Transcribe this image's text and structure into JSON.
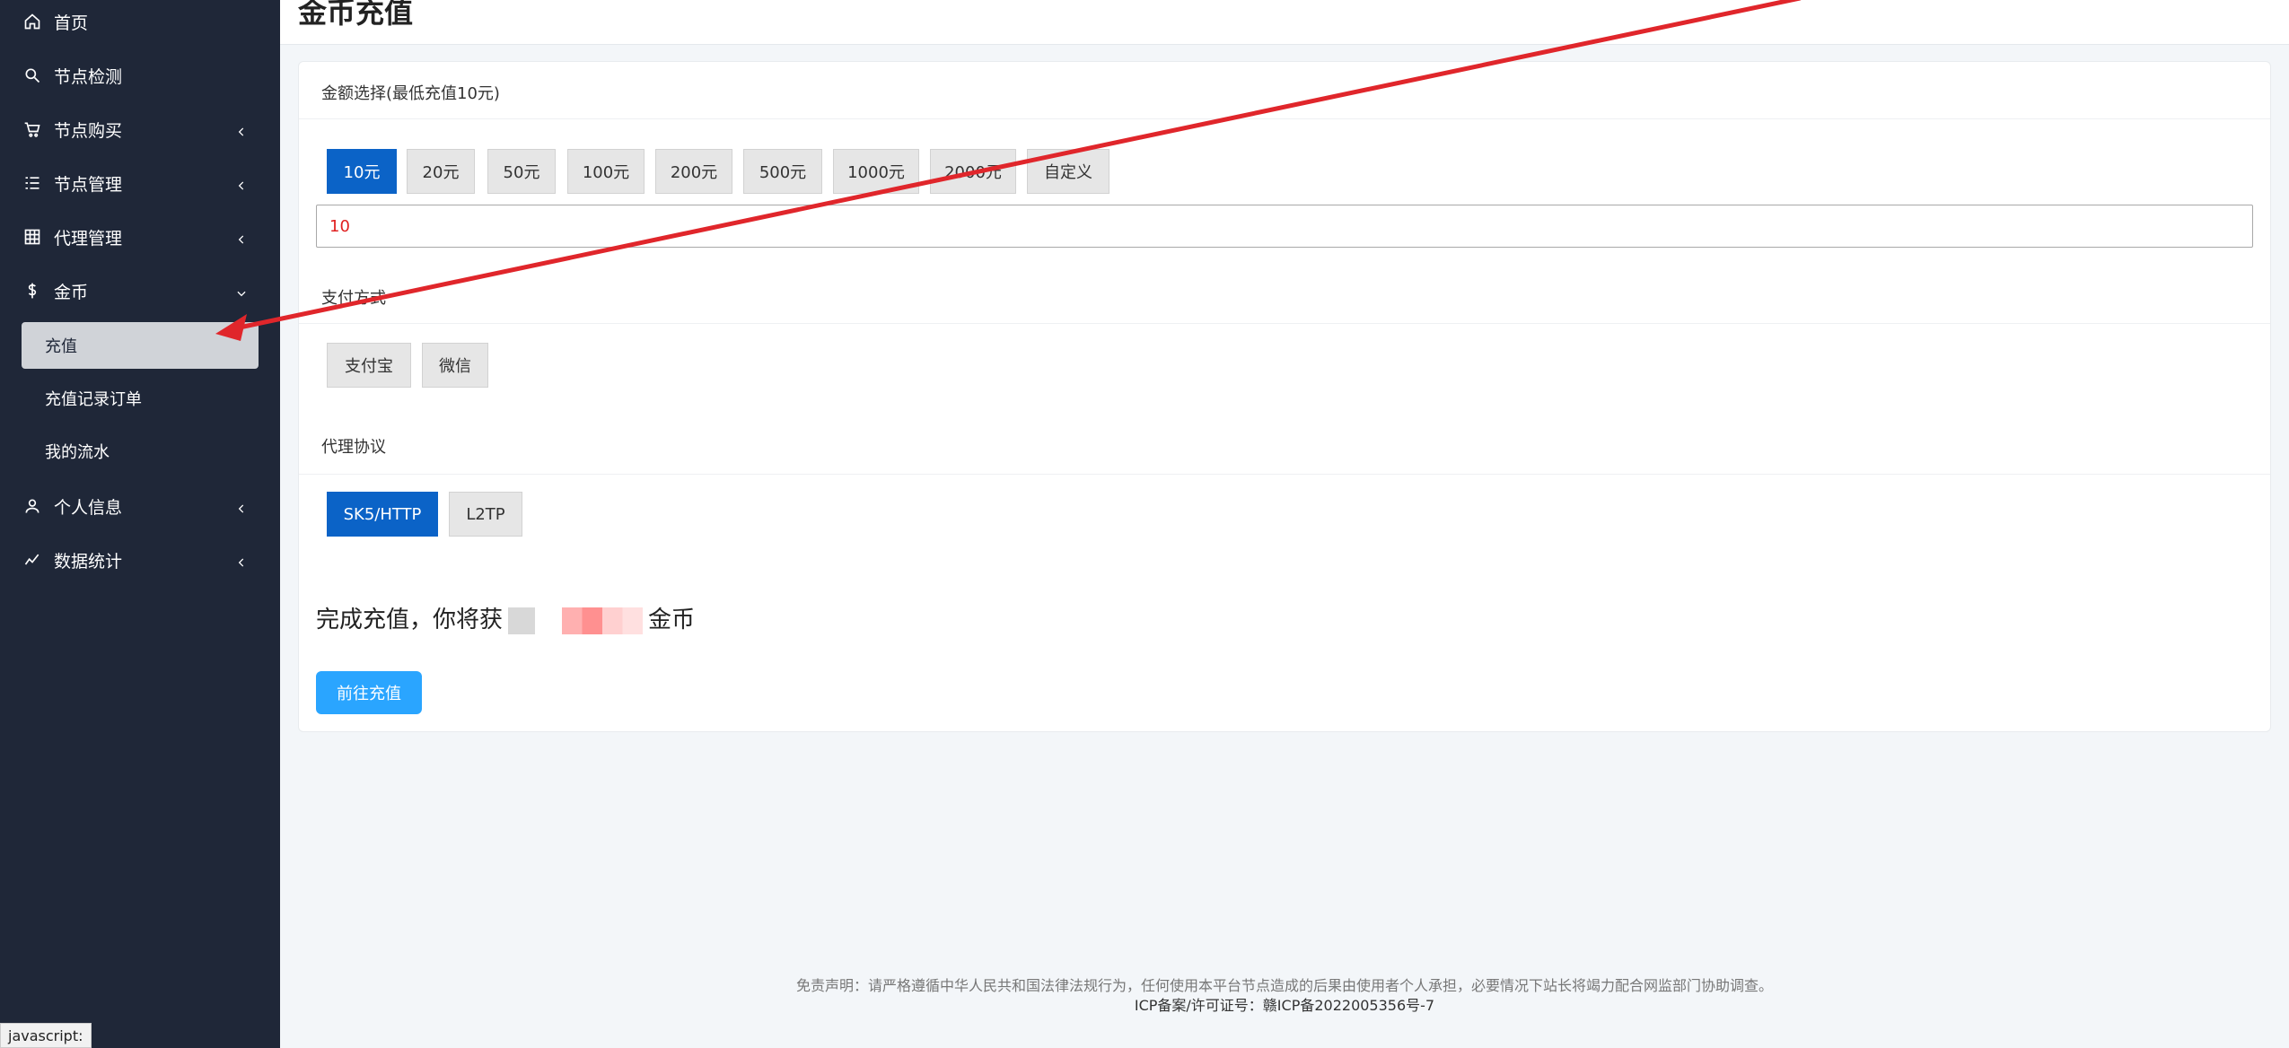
{
  "sidebar": {
    "items": [
      {
        "label": "首页",
        "icon": "home-icon"
      },
      {
        "label": "节点检测",
        "icon": "search-icon"
      },
      {
        "label": "节点购买",
        "icon": "cart-icon"
      },
      {
        "label": "节点管理",
        "icon": "list-icon"
      },
      {
        "label": "代理管理",
        "icon": "grid-icon"
      },
      {
        "label": "金币",
        "icon": "dollar-icon"
      },
      {
        "label": "个人信息",
        "icon": "user-icon"
      },
      {
        "label": "数据统计",
        "icon": "chart-line-icon"
      }
    ],
    "sub_items": [
      {
        "label": "充值",
        "active": true
      },
      {
        "label": "充值记录订单"
      },
      {
        "label": "我的流水"
      }
    ]
  },
  "page": {
    "title": "金币充值"
  },
  "amount": {
    "label": "金额选择(最低充值10元)",
    "options": [
      "10元",
      "20元",
      "50元",
      "100元",
      "200元",
      "500元",
      "1000元",
      "2000元",
      "自定义"
    ],
    "selected": "10元",
    "input_value": "10"
  },
  "payment": {
    "label": "支付方式",
    "options": [
      "支付宝",
      "微信"
    ]
  },
  "protocol": {
    "label": "代理协议",
    "options": [
      "SK5/HTTP",
      "L2TP"
    ],
    "selected": "SK5/HTTP"
  },
  "result": {
    "prefix": "完成充值，你将获",
    "suffix": "金币"
  },
  "submit_label": "前往充值",
  "footer": {
    "disclaimer": "免责声明：请严格遵循中华人民共和国法律法规行为，任何使用本平台节点造成的后果由使用者个人承担，必要情况下站长将竭力配合网监部门协助调查。",
    "icp": "ICP备案/许可证号：赣ICP备2022005356号-7"
  },
  "statusbar": "javascript:",
  "colors": {
    "sidebar_bg": "#1f2738",
    "active_blue": "#0b63c7",
    "submit_blue": "#2aa5ff",
    "annotation_red": "#e0262b"
  }
}
